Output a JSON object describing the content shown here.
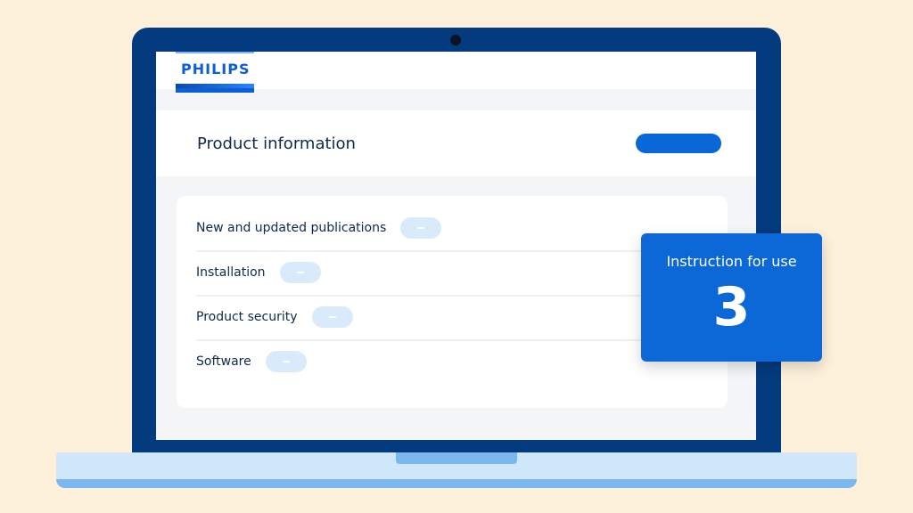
{
  "brand": {
    "logo_text": "PHILIPS",
    "accent": "#0b5ed7"
  },
  "header": {
    "title": "Product information",
    "button_color": "#0a67d8"
  },
  "list": {
    "items": [
      {
        "label": "New and updated publications",
        "toggle_icon": "minus-icon"
      },
      {
        "label": "Installation",
        "toggle_icon": "minus-icon"
      },
      {
        "label": "Product security",
        "toggle_icon": "minus-icon"
      },
      {
        "label": "Software",
        "toggle_icon": "minus-icon"
      }
    ]
  },
  "callout": {
    "title": "Instruction for use",
    "count": "3",
    "color": "#0b68d6"
  },
  "colors": {
    "background": "#fdf1dc",
    "laptop_frame": "#043b7f",
    "laptop_base": "#cfe6fb"
  }
}
